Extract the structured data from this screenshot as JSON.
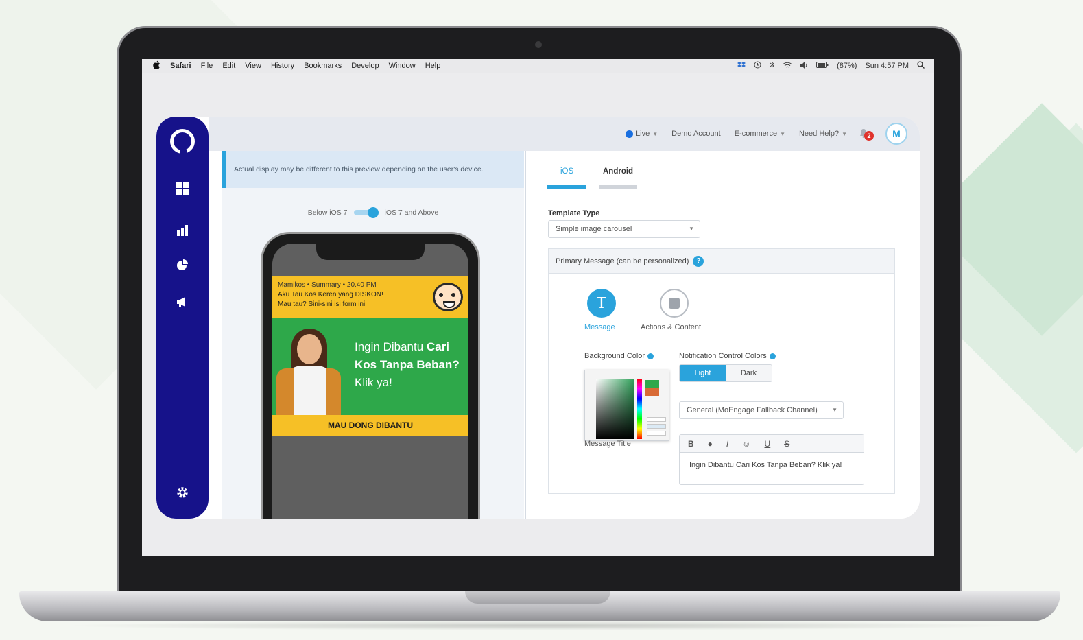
{
  "menubar": {
    "apple": "",
    "app_name": "Safari",
    "items": [
      "File",
      "Edit",
      "View",
      "History",
      "Bookmarks",
      "Develop",
      "Window",
      "Help"
    ],
    "battery": "(87%)",
    "clock": "Sun 4:57 PM"
  },
  "topbar": {
    "live_label": "Live",
    "account_label": "Demo Account",
    "vertical_label": "E-commerce",
    "help_label": "Need Help?",
    "notification_count": "2",
    "avatar_initial": "M"
  },
  "preview": {
    "note": "Actual display may be different to this preview depending on the user's device.",
    "toggle_left": "Below iOS 7",
    "toggle_right": "iOS 7 and Above",
    "notification": {
      "header": "Mamikos • Summary • 20.40 PM",
      "line1": "Aku Tau Kos Keren yang DISKON!",
      "line2": "Mau tau? Sini-sini isi form ini"
    },
    "banner": {
      "text_a": "Ingin Dibantu",
      "text_b": "Cari",
      "text_c": "Kos Tanpa Beban?",
      "text_d": "Klik ya!"
    },
    "cta": "MAU DONG DIBANTU"
  },
  "settings": {
    "tabs": [
      "iOS",
      "Android"
    ],
    "template_type_label": "Template Type",
    "template_type_value": "Simple image carousel",
    "primary_message_label": "Primary Message (can be personalized)",
    "help_mark": "?",
    "steps": [
      "Message",
      "Actions & Content"
    ],
    "bg_color_label": "Background Color",
    "notif_colors_label": "Notification Control Colors",
    "light_label": "Light",
    "dark_label": "Dark",
    "channel_value": "General (MoEngage Fallback Channel)",
    "message_title_label": "Message Title",
    "editor_tools": [
      "B",
      "●",
      "I",
      "☺",
      "U",
      "S"
    ],
    "message_title_value": "Ingin Dibantu Cari Kos Tanpa Beban? Klik ya!"
  },
  "colors": {
    "sidebar": "#16128a",
    "accent": "#2aa3dc",
    "banner_green": "#2ea84a",
    "banner_yellow": "#f6c026"
  },
  "icons": {
    "sidebar": [
      "logo-icon",
      "dashboard-icon",
      "analytics-icon",
      "segments-icon",
      "campaign-icon",
      "settings-icon"
    ]
  }
}
